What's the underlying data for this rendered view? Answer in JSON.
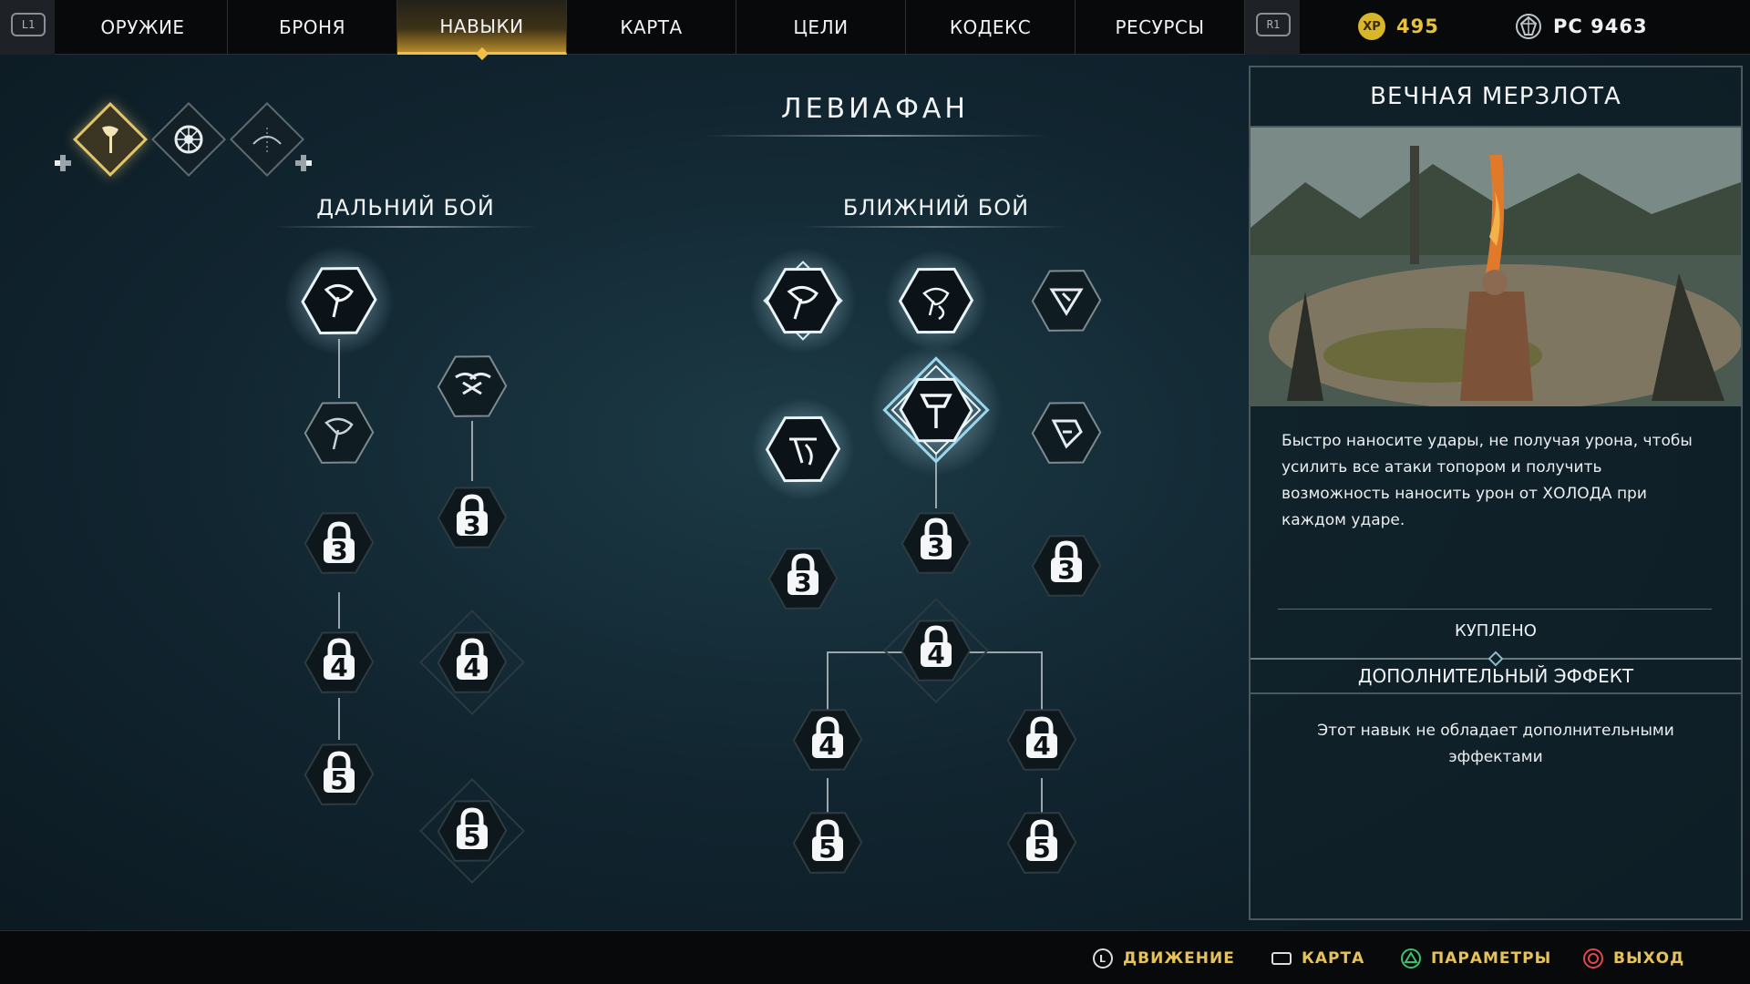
{
  "nav": {
    "left_bumper": "L1",
    "right_bumper": "R1",
    "tabs": [
      "ОРУЖИЕ",
      "БРОНЯ",
      "НАВЫКИ",
      "КАРТА",
      "ЦЕЛИ",
      "КОДЕКС",
      "РЕСУРСЫ"
    ],
    "active_tab": "НАВЫКИ",
    "xp_label": "XP",
    "xp_value": "495",
    "hacksilver_value": "РС 9463"
  },
  "weapon_selector": {
    "icons": [
      "axe-icon",
      "shield-icon",
      "bow-icon"
    ],
    "active": "axe-icon"
  },
  "tree": {
    "title": "ЛЕВИАФАН",
    "ranged_heading": "ДАЛЬНИЙ БОЙ",
    "melee_heading": "БЛИЖНИЙ БОЙ",
    "locked_levels": [
      "3",
      "3",
      "4",
      "4",
      "5",
      "5",
      "3",
      "3",
      "3",
      "4",
      "4",
      "4",
      "5",
      "5"
    ]
  },
  "panel": {
    "title": "ВЕЧНАЯ МЕРЗЛОТА",
    "description": "Быстро наносите удары, не получая урона, чтобы усилить все атаки топором и получить возможность наносить урон от ХОЛОДА при каждом ударе.",
    "status": "КУПЛЕНО",
    "extra_heading": "ДОПОЛНИТЕЛЬНЫЙ ЭФФЕКТ",
    "extra_text": "Этот навык не обладает дополнительными эффектами"
  },
  "footer": {
    "move": "ДВИЖЕНИЕ",
    "map": "КАРТА",
    "options": "ПАРАМЕТРЫ",
    "exit": "ВЫХОД"
  },
  "colors": {
    "accent_gold": "#e6c25a",
    "xp_gold": "#d8b62a",
    "background": "#112530"
  }
}
